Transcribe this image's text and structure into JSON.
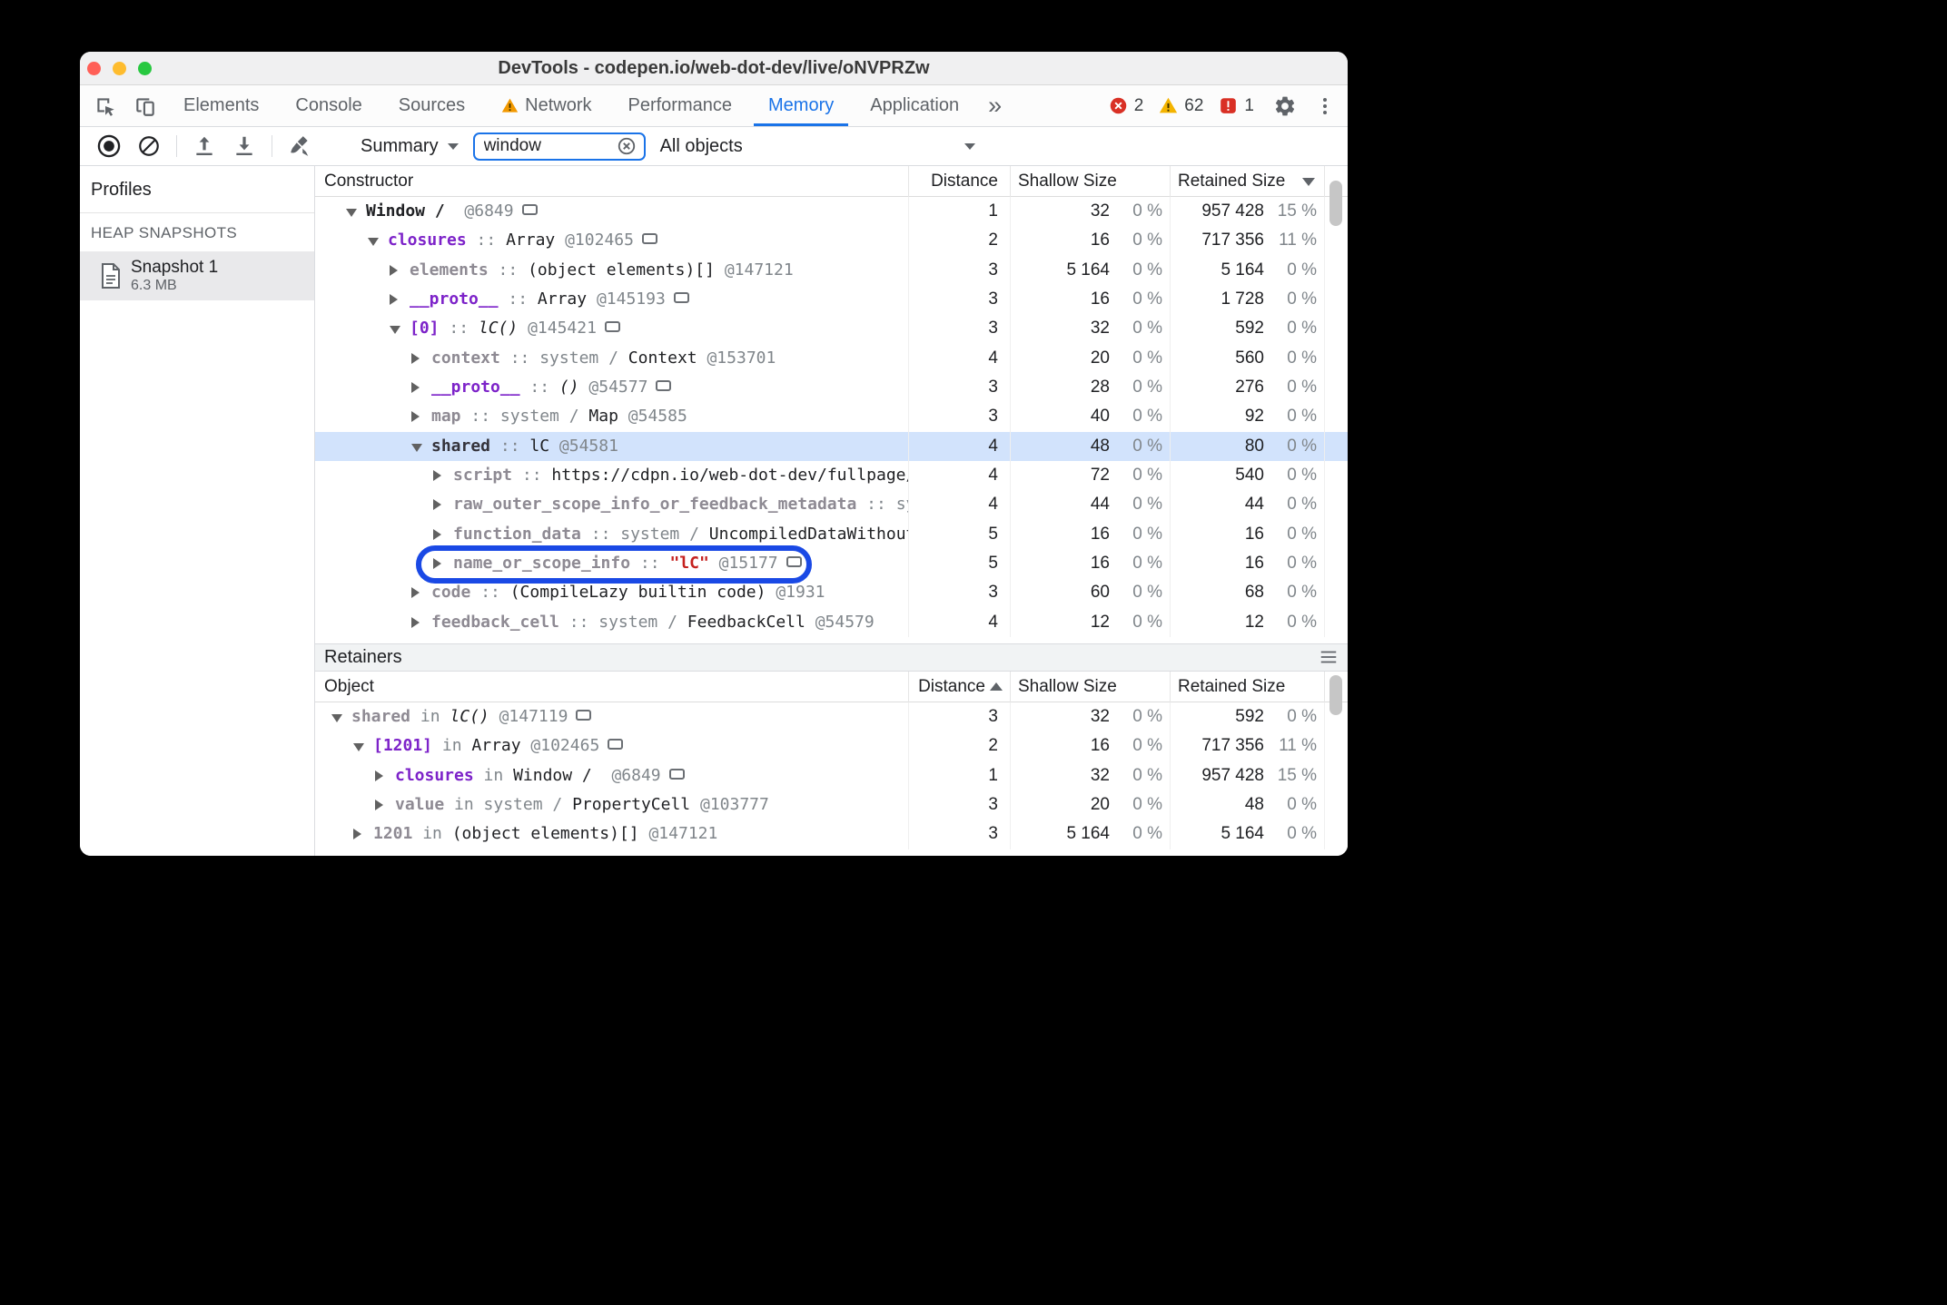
{
  "window": {
    "title": "DevTools - codepen.io/web-dot-dev/live/oNVPRZw"
  },
  "tabs": {
    "items": [
      {
        "label": "Elements",
        "active": false,
        "warning": false
      },
      {
        "label": "Console",
        "active": false,
        "warning": false
      },
      {
        "label": "Sources",
        "active": false,
        "warning": false
      },
      {
        "label": "Network",
        "active": false,
        "warning": true
      },
      {
        "label": "Performance",
        "active": false,
        "warning": false
      },
      {
        "label": "Memory",
        "active": true,
        "warning": false
      },
      {
        "label": "Application",
        "active": false,
        "warning": false
      }
    ],
    "more_label": "»",
    "error_count": "2",
    "warning_count": "62",
    "issue_count": "1"
  },
  "toolbar": {
    "summary_label": "Summary",
    "search_value": "window",
    "filter_label": "All objects"
  },
  "sidebar": {
    "title": "Profiles",
    "section": "HEAP SNAPSHOTS",
    "snapshot": {
      "name": "Snapshot 1",
      "size": "6.3 MB"
    }
  },
  "grid": {
    "headers": {
      "constructor": "Constructor",
      "distance": "Distance",
      "shallow": "Shallow Size",
      "retained": "Retained Size"
    },
    "rows": [
      {
        "indent": 0,
        "arrow": "down",
        "name": "Window /",
        "name_style": "black",
        "sep": "  ",
        "parts": [
          {
            "t": "@6849",
            "s": "gray"
          }
        ],
        "reveal": true,
        "selected": false,
        "annotated": false,
        "distance": "1",
        "shallow": "32",
        "shallow_pct": "0 %",
        "retained": "957 428",
        "retained_pct": "15 %"
      },
      {
        "indent": 1,
        "arrow": "down",
        "name": "closures",
        "name_style": "purple",
        "sep": " :: ",
        "parts": [
          {
            "t": "Array ",
            "s": "black"
          },
          {
            "t": "@102465",
            "s": "gray"
          }
        ],
        "reveal": true,
        "selected": false,
        "annotated": false,
        "distance": "2",
        "shallow": "16",
        "shallow_pct": "0 %",
        "retained": "717 356",
        "retained_pct": "11 %"
      },
      {
        "indent": 2,
        "arrow": "right",
        "name": "elements",
        "name_style": "gray",
        "sep": " :: ",
        "parts": [
          {
            "t": "(object elements)[] ",
            "s": "black"
          },
          {
            "t": "@147121",
            "s": "gray"
          }
        ],
        "reveal": false,
        "selected": false,
        "annotated": false,
        "distance": "3",
        "shallow": "5 164",
        "shallow_pct": "0 %",
        "retained": "5 164",
        "retained_pct": "0 %"
      },
      {
        "indent": 2,
        "arrow": "right",
        "name": "__proto__",
        "name_style": "purple",
        "sep": " :: ",
        "parts": [
          {
            "t": "Array ",
            "s": "black"
          },
          {
            "t": "@145193",
            "s": "gray"
          }
        ],
        "reveal": true,
        "selected": false,
        "annotated": false,
        "distance": "3",
        "shallow": "16",
        "shallow_pct": "0 %",
        "retained": "1 728",
        "retained_pct": "0 %"
      },
      {
        "indent": 2,
        "arrow": "down",
        "name": "[0]",
        "name_style": "purple",
        "sep": " :: ",
        "parts": [
          {
            "t": "lC() ",
            "s": "italic"
          },
          {
            "t": "@145421",
            "s": "gray"
          }
        ],
        "reveal": true,
        "selected": false,
        "annotated": false,
        "distance": "3",
        "shallow": "32",
        "shallow_pct": "0 %",
        "retained": "592",
        "retained_pct": "0 %"
      },
      {
        "indent": 3,
        "arrow": "right",
        "name": "context",
        "name_style": "gray",
        "sep": " :: ",
        "parts": [
          {
            "t": "system / ",
            "s": "gray"
          },
          {
            "t": "Context ",
            "s": "black"
          },
          {
            "t": "@153701",
            "s": "gray"
          }
        ],
        "reveal": false,
        "selected": false,
        "annotated": false,
        "distance": "4",
        "shallow": "20",
        "shallow_pct": "0 %",
        "retained": "560",
        "retained_pct": "0 %"
      },
      {
        "indent": 3,
        "arrow": "right",
        "name": "__proto__",
        "name_style": "purple",
        "sep": " :: ",
        "parts": [
          {
            "t": "() ",
            "s": "italic"
          },
          {
            "t": "@54577",
            "s": "gray"
          }
        ],
        "reveal": true,
        "selected": false,
        "annotated": false,
        "distance": "3",
        "shallow": "28",
        "shallow_pct": "0 %",
        "retained": "276",
        "retained_pct": "0 %"
      },
      {
        "indent": 3,
        "arrow": "right",
        "name": "map",
        "name_style": "gray",
        "sep": " :: ",
        "parts": [
          {
            "t": "system / ",
            "s": "gray"
          },
          {
            "t": "Map ",
            "s": "black"
          },
          {
            "t": "@54585",
            "s": "gray"
          }
        ],
        "reveal": false,
        "selected": false,
        "annotated": false,
        "distance": "3",
        "shallow": "40",
        "shallow_pct": "0 %",
        "retained": "92",
        "retained_pct": "0 %"
      },
      {
        "indent": 3,
        "arrow": "down",
        "name": "shared",
        "name_style": "dark",
        "sep": " :: ",
        "parts": [
          {
            "t": "lC ",
            "s": "black"
          },
          {
            "t": "@54581",
            "s": "gray"
          }
        ],
        "reveal": false,
        "selected": true,
        "annotated": false,
        "distance": "4",
        "shallow": "48",
        "shallow_pct": "0 %",
        "retained": "80",
        "retained_pct": "0 %"
      },
      {
        "indent": 4,
        "arrow": "right",
        "name": "script",
        "name_style": "gray",
        "sep": " :: ",
        "parts": [
          {
            "t": "https://cdpn.io/web-dot-dev/fullpage/l",
            "s": "black"
          }
        ],
        "reveal": false,
        "selected": false,
        "annotated": false,
        "distance": "4",
        "shallow": "72",
        "shallow_pct": "0 %",
        "retained": "540",
        "retained_pct": "0 %"
      },
      {
        "indent": 4,
        "arrow": "right",
        "name": "raw_outer_scope_info_or_feedback_metadata",
        "name_style": "gray",
        "sep": " :: ",
        "parts": [
          {
            "t": "sys",
            "s": "gray"
          }
        ],
        "reveal": false,
        "selected": false,
        "annotated": false,
        "distance": "4",
        "shallow": "44",
        "shallow_pct": "0 %",
        "retained": "44",
        "retained_pct": "0 %"
      },
      {
        "indent": 4,
        "arrow": "right",
        "name": "function_data",
        "name_style": "gray",
        "sep": " :: ",
        "parts": [
          {
            "t": "system / ",
            "s": "gray"
          },
          {
            "t": "UncompiledDataWithoutP",
            "s": "black"
          }
        ],
        "reveal": false,
        "selected": false,
        "annotated": false,
        "distance": "5",
        "shallow": "16",
        "shallow_pct": "0 %",
        "retained": "16",
        "retained_pct": "0 %"
      },
      {
        "indent": 4,
        "arrow": "right",
        "name": "name_or_scope_info",
        "name_style": "gray",
        "sep": " :: ",
        "parts": [
          {
            "t": "\"lC\" ",
            "s": "red"
          },
          {
            "t": "@15177",
            "s": "gray"
          }
        ],
        "reveal": true,
        "selected": false,
        "annotated": true,
        "distance": "5",
        "shallow": "16",
        "shallow_pct": "0 %",
        "retained": "16",
        "retained_pct": "0 %"
      },
      {
        "indent": 3,
        "arrow": "right",
        "name": "code",
        "name_style": "gray",
        "sep": " :: ",
        "parts": [
          {
            "t": "(CompileLazy builtin code) ",
            "s": "black"
          },
          {
            "t": "@1931",
            "s": "gray"
          }
        ],
        "reveal": false,
        "selected": false,
        "annotated": false,
        "distance": "3",
        "shallow": "60",
        "shallow_pct": "0 %",
        "retained": "68",
        "retained_pct": "0 %"
      },
      {
        "indent": 3,
        "arrow": "right",
        "name": "feedback_cell",
        "name_style": "gray",
        "sep": " :: ",
        "parts": [
          {
            "t": "system / ",
            "s": "gray"
          },
          {
            "t": "FeedbackCell ",
            "s": "black"
          },
          {
            "t": "@54579",
            "s": "gray"
          }
        ],
        "reveal": false,
        "selected": false,
        "annotated": false,
        "distance": "4",
        "shallow": "12",
        "shallow_pct": "0 %",
        "retained": "12",
        "retained_pct": "0 %"
      }
    ]
  },
  "retainers": {
    "title": "Retainers",
    "headers": {
      "object": "Object",
      "distance": "Distance",
      "shallow": "Shallow Size",
      "retained": "Retained Size"
    },
    "rows": [
      {
        "indent": 0,
        "arrow": "down",
        "name": "shared",
        "name_style": "gray",
        "sep": " in ",
        "parts": [
          {
            "t": "lC() ",
            "s": "italic"
          },
          {
            "t": "@147119",
            "s": "gray"
          }
        ],
        "reveal": true,
        "selected": false,
        "annotated": false,
        "distance": "3",
        "shallow": "32",
        "shallow_pct": "0 %",
        "retained": "592",
        "retained_pct": "0 %"
      },
      {
        "indent": 1,
        "arrow": "down",
        "name": "[1201]",
        "name_style": "purple",
        "sep": " in ",
        "parts": [
          {
            "t": "Array ",
            "s": "black"
          },
          {
            "t": "@102465",
            "s": "gray"
          }
        ],
        "reveal": true,
        "selected": false,
        "annotated": false,
        "distance": "2",
        "shallow": "16",
        "shallow_pct": "0 %",
        "retained": "717 356",
        "retained_pct": "11 %"
      },
      {
        "indent": 2,
        "arrow": "right",
        "name": "closures",
        "name_style": "purple",
        "sep": " in ",
        "parts": [
          {
            "t": "Window /  ",
            "s": "black"
          },
          {
            "t": "@6849",
            "s": "gray"
          }
        ],
        "reveal": true,
        "selected": false,
        "annotated": false,
        "distance": "1",
        "shallow": "32",
        "shallow_pct": "0 %",
        "retained": "957 428",
        "retained_pct": "15 %"
      },
      {
        "indent": 2,
        "arrow": "right",
        "name": "value",
        "name_style": "gray",
        "sep": " in ",
        "parts": [
          {
            "t": "system / ",
            "s": "gray"
          },
          {
            "t": "PropertyCell ",
            "s": "black"
          },
          {
            "t": "@103777",
            "s": "gray"
          }
        ],
        "reveal": false,
        "selected": false,
        "annotated": false,
        "distance": "3",
        "shallow": "20",
        "shallow_pct": "0 %",
        "retained": "48",
        "retained_pct": "0 %"
      },
      {
        "indent": 1,
        "arrow": "right",
        "name": "1201",
        "name_style": "gray",
        "sep": " in ",
        "parts": [
          {
            "t": "(object elements)[] ",
            "s": "black"
          },
          {
            "t": "@147121",
            "s": "gray"
          }
        ],
        "reveal": false,
        "selected": false,
        "annotated": false,
        "distance": "3",
        "shallow": "5 164",
        "shallow_pct": "0 %",
        "retained": "5 164",
        "retained_pct": "0 %"
      }
    ]
  },
  "colors": {
    "accent": "#1a73e8",
    "selection_bg": "#d2e3fc",
    "annotation_blue": "#1a49e5",
    "string_red": "#c5221f",
    "property_purple": "#7d23c9",
    "internal_gray": "#8e8a93",
    "id_gray": "#80868b",
    "text_dark": "#202124",
    "error_red": "#d93025",
    "warning_yellow": "#f4b400",
    "traffic_close": "#ff5f57",
    "traffic_min": "#febc2e",
    "traffic_max": "#28c840"
  }
}
